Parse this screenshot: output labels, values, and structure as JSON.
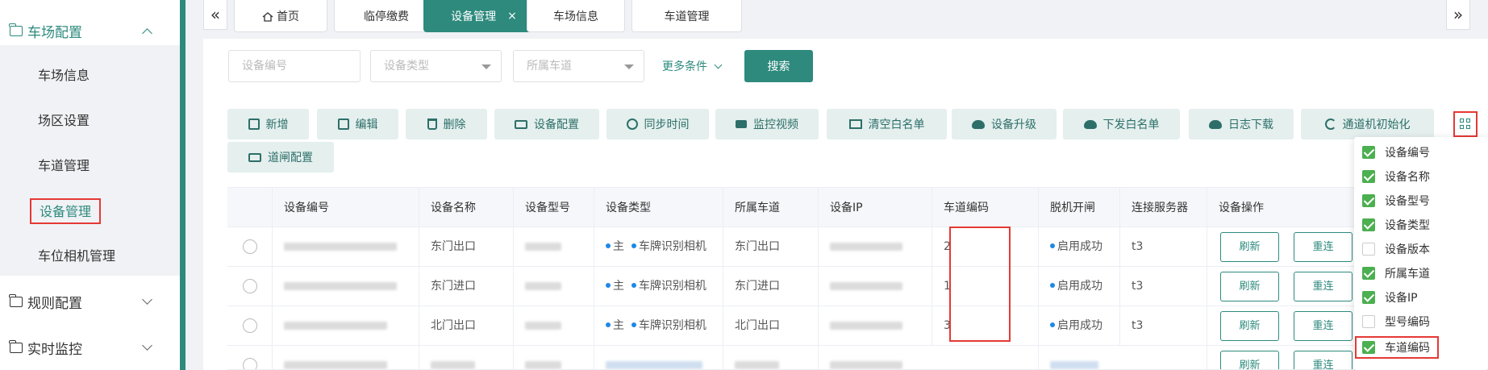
{
  "sidebar": {
    "groups": [
      {
        "label": "车场配置",
        "open": true
      },
      {
        "label": "规则配置",
        "open": false
      },
      {
        "label": "实时监控",
        "open": false
      }
    ],
    "items": [
      {
        "label": "车场信息"
      },
      {
        "label": "场区设置"
      },
      {
        "label": "车道管理"
      },
      {
        "label": "设备管理",
        "active": true
      },
      {
        "label": "车位相机管理"
      }
    ]
  },
  "tabs": {
    "prev": "«",
    "next": "»",
    "items": [
      {
        "label": "首页"
      },
      {
        "label": "临停缴费"
      },
      {
        "label": "设备管理",
        "active": true,
        "close": "×"
      },
      {
        "label": "车场信息"
      },
      {
        "label": "车道管理"
      }
    ]
  },
  "filters": {
    "device_code_placeholder": "设备编号",
    "device_type_placeholder": "设备类型",
    "lane_placeholder": "所属车道",
    "more_label": "更多条件",
    "search_label": "搜索"
  },
  "actions": [
    {
      "label": "新增",
      "icon": "plus-square-icon"
    },
    {
      "label": "编辑",
      "icon": "edit-icon"
    },
    {
      "label": "删除",
      "icon": "trash-icon"
    },
    {
      "label": "设备配置",
      "icon": "monitor-icon"
    },
    {
      "label": "同步时间",
      "icon": "clock-icon"
    },
    {
      "label": "监控视频",
      "icon": "video-icon"
    },
    {
      "label": "清空白名单",
      "icon": "list-icon"
    },
    {
      "label": "设备升级",
      "icon": "cloud-upload-icon"
    },
    {
      "label": "下发白名单",
      "icon": "cloud-upload-icon"
    },
    {
      "label": "日志下载",
      "icon": "cloud-download-icon"
    },
    {
      "label": "通道机初始化",
      "icon": "refresh-icon"
    },
    {
      "label": "道闸配置",
      "icon": "monitor-icon"
    }
  ],
  "table": {
    "headers": [
      "设备编号",
      "设备名称",
      "设备型号",
      "设备类型",
      "所属车道",
      "设备IP",
      "车道编码",
      "脱机开闸",
      "连接服务器",
      "设备操作"
    ],
    "rows": [
      {
        "name": "东门出口",
        "type_main": "主",
        "type_name": "车牌识别相机",
        "lane": "东门出口",
        "lane_code": "2",
        "offline": "启用成功",
        "server": "t3",
        "op1": "刷新",
        "op2": "重连"
      },
      {
        "name": "东门进口",
        "type_main": "主",
        "type_name": "车牌识别相机",
        "lane": "东门进口",
        "lane_code": "1",
        "offline": "启用成功",
        "server": "t3",
        "op1": "刷新",
        "op2": "重连"
      },
      {
        "name": "北门出口",
        "type_main": "主",
        "type_name": "车牌识别相机",
        "lane": "北门出口",
        "lane_code": "3",
        "offline": "启用成功",
        "server": "t3",
        "op1": "刷新",
        "op2": "重连"
      },
      {
        "name": "",
        "type_main": "",
        "type_name": "",
        "lane": "",
        "lane_code": "",
        "offline": "",
        "server": "",
        "op1": "刷新",
        "op2": "重连"
      }
    ]
  },
  "column_menu": {
    "items": [
      {
        "label": "设备编号",
        "checked": true
      },
      {
        "label": "设备名称",
        "checked": true
      },
      {
        "label": "设备型号",
        "checked": true
      },
      {
        "label": "设备类型",
        "checked": true
      },
      {
        "label": "设备版本",
        "checked": false
      },
      {
        "label": "所属车道",
        "checked": true
      },
      {
        "label": "设备IP",
        "checked": true
      },
      {
        "label": "型号编码",
        "checked": false
      },
      {
        "label": "车道编码",
        "checked": true
      }
    ]
  },
  "colors": {
    "accent": "#2d8a7d",
    "highlight": "#e53935",
    "check": "#4caf50",
    "dot": "#1e88e5"
  }
}
